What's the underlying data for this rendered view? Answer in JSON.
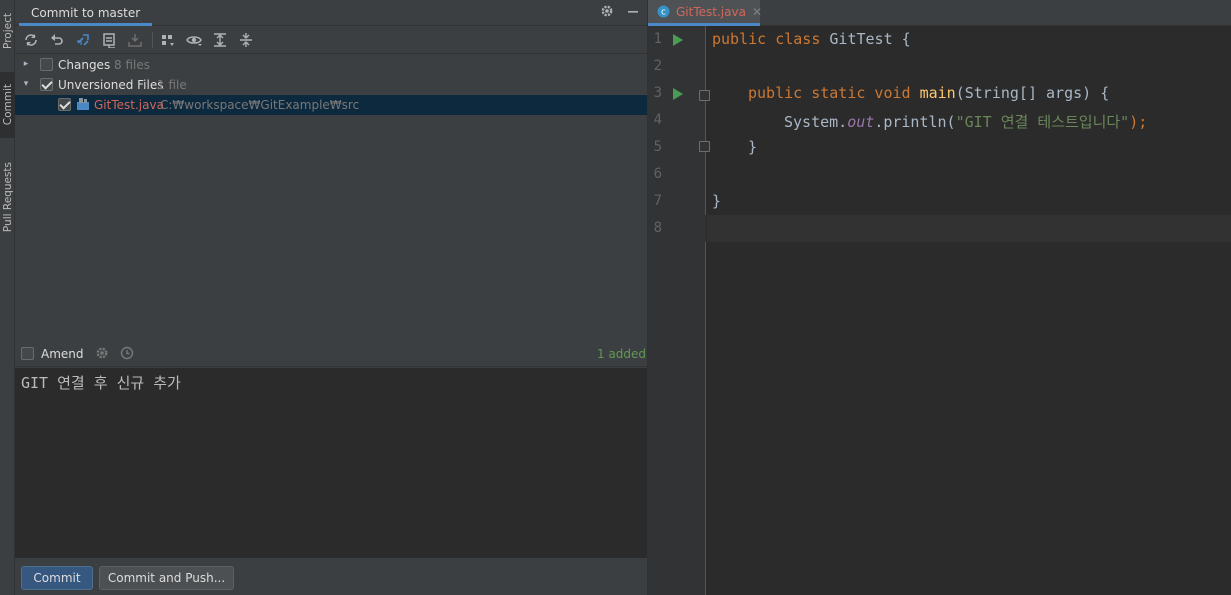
{
  "stripe": {
    "tabs": [
      {
        "label": "Project"
      },
      {
        "label": "Commit"
      },
      {
        "label": "Pull Requests"
      }
    ]
  },
  "commit_panel": {
    "title": "Commit to master",
    "tree": {
      "changes": {
        "label": "Changes",
        "count": "8 files"
      },
      "unversioned": {
        "label": "Unversioned Files",
        "count": "1 file"
      },
      "file": {
        "name": "GitTest.java",
        "path": "C:₩workspace₩GitExample₩src"
      }
    },
    "amend_label": "Amend",
    "added_status": "1 added",
    "message": "GIT 연결 후 신규 추가",
    "commit_button": "Commit",
    "commit_push_button": "Commit and Push..."
  },
  "editor": {
    "tab_name": "GitTest.java",
    "line_numbers": [
      "1",
      "2",
      "3",
      "4",
      "5",
      "6",
      "7",
      "8"
    ],
    "code": {
      "l1_kw": "public class ",
      "l1_rest": "GitTest {",
      "l3_kw": "public static void ",
      "l3_fn": "main",
      "l3_rest": "(String[] args) {",
      "l4_a": "System.",
      "l4_field": "out",
      "l4_b": ".println(",
      "l4_str": "\"GIT 연결 테스트입니다\"",
      "l4_c": ");",
      "l5": "}",
      "l7": "}"
    }
  },
  "colors": {
    "accent": "#4a88c7",
    "run": "#499c54",
    "added": "#629755",
    "unversioned_file": "#d1675a"
  }
}
